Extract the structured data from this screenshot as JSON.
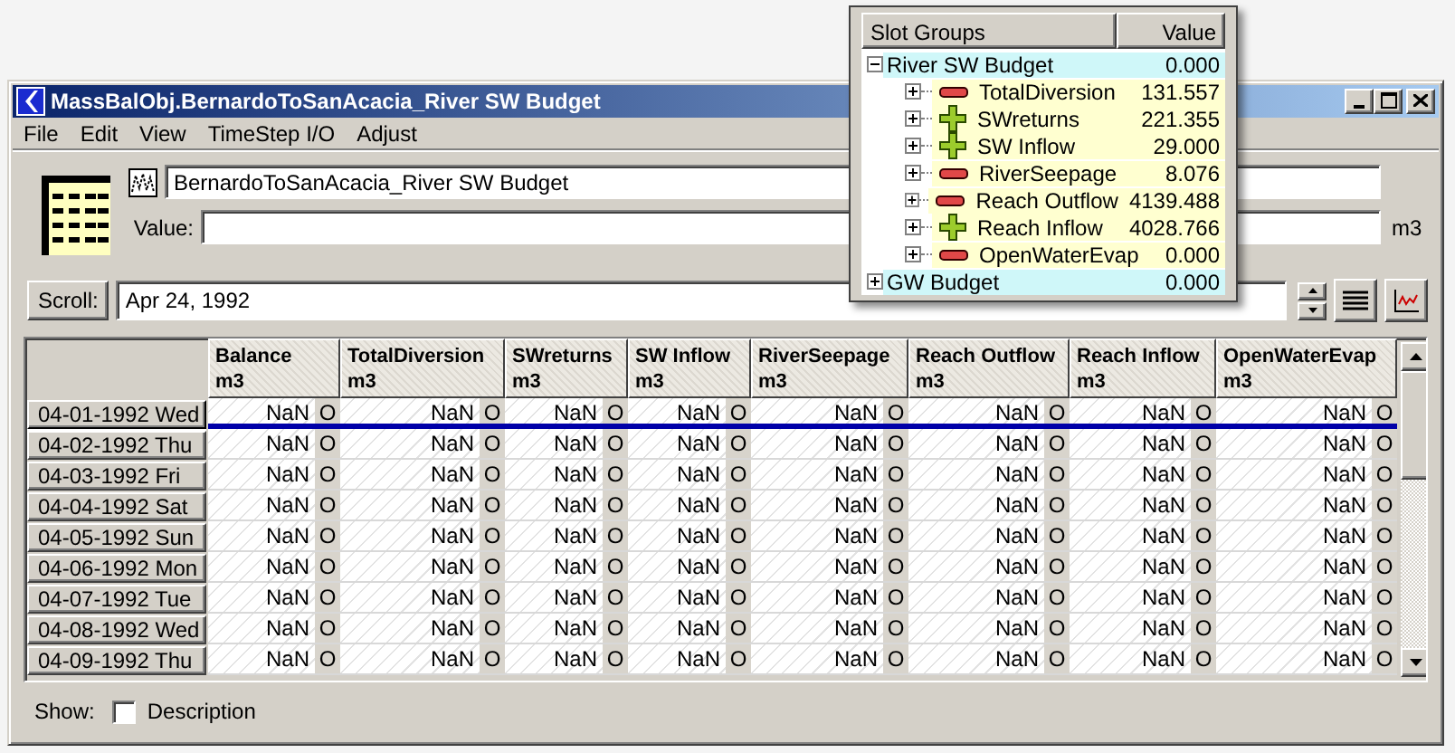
{
  "window": {
    "title": "MassBalObj.BernardoToSanAcacia_River SW Budget"
  },
  "menu": [
    "File",
    "Edit",
    "View",
    "TimeStep I/O",
    "Adjust"
  ],
  "object_name": "BernardoToSanAcacia_River SW Budget",
  "value_field": {
    "label": "Value:",
    "unit": "m3"
  },
  "scroll": {
    "button": "Scroll:",
    "value": "Apr 24, 1992"
  },
  "table": {
    "columns": [
      {
        "name": "Balance",
        "unit": "m3"
      },
      {
        "name": "TotalDiversion",
        "unit": "m3"
      },
      {
        "name": "SWreturns",
        "unit": "m3"
      },
      {
        "name": "SW Inflow",
        "unit": "m3"
      },
      {
        "name": "RiverSeepage",
        "unit": "m3"
      },
      {
        "name": "Reach Outflow",
        "unit": "m3"
      },
      {
        "name": "Reach Inflow",
        "unit": "m3"
      },
      {
        "name": "OpenWaterEvap",
        "unit": "m3"
      }
    ],
    "rows": [
      {
        "date": "04-01-1992 Wed",
        "selected": true,
        "cells": [
          {
            "value": "NaN",
            "flag": "O"
          },
          {
            "value": "NaN",
            "flag": "O"
          },
          {
            "value": "NaN",
            "flag": "O"
          },
          {
            "value": "NaN",
            "flag": "O"
          },
          {
            "value": "NaN",
            "flag": "O"
          },
          {
            "value": "NaN",
            "flag": "O"
          },
          {
            "value": "NaN",
            "flag": "O"
          },
          {
            "value": "NaN",
            "flag": "O"
          }
        ]
      },
      {
        "date": "04-02-1992 Thu",
        "selected": false,
        "cells": [
          {
            "value": "NaN",
            "flag": "O"
          },
          {
            "value": "NaN",
            "flag": "O"
          },
          {
            "value": "NaN",
            "flag": "O"
          },
          {
            "value": "NaN",
            "flag": "O"
          },
          {
            "value": "NaN",
            "flag": "O"
          },
          {
            "value": "NaN",
            "flag": "O"
          },
          {
            "value": "NaN",
            "flag": "O"
          },
          {
            "value": "NaN",
            "flag": "O"
          }
        ]
      },
      {
        "date": "04-03-1992 Fri",
        "selected": false,
        "cells": [
          {
            "value": "NaN",
            "flag": "O"
          },
          {
            "value": "NaN",
            "flag": "O"
          },
          {
            "value": "NaN",
            "flag": "O"
          },
          {
            "value": "NaN",
            "flag": "O"
          },
          {
            "value": "NaN",
            "flag": "O"
          },
          {
            "value": "NaN",
            "flag": "O"
          },
          {
            "value": "NaN",
            "flag": "O"
          },
          {
            "value": "NaN",
            "flag": "O"
          }
        ]
      },
      {
        "date": "04-04-1992 Sat",
        "selected": false,
        "cells": [
          {
            "value": "NaN",
            "flag": "O"
          },
          {
            "value": "NaN",
            "flag": "O"
          },
          {
            "value": "NaN",
            "flag": "O"
          },
          {
            "value": "NaN",
            "flag": "O"
          },
          {
            "value": "NaN",
            "flag": "O"
          },
          {
            "value": "NaN",
            "flag": "O"
          },
          {
            "value": "NaN",
            "flag": "O"
          },
          {
            "value": "NaN",
            "flag": "O"
          }
        ]
      },
      {
        "date": "04-05-1992 Sun",
        "selected": false,
        "cells": [
          {
            "value": "NaN",
            "flag": "O"
          },
          {
            "value": "NaN",
            "flag": "O"
          },
          {
            "value": "NaN",
            "flag": "O"
          },
          {
            "value": "NaN",
            "flag": "O"
          },
          {
            "value": "NaN",
            "flag": "O"
          },
          {
            "value": "NaN",
            "flag": "O"
          },
          {
            "value": "NaN",
            "flag": "O"
          },
          {
            "value": "NaN",
            "flag": "O"
          }
        ]
      },
      {
        "date": "04-06-1992 Mon",
        "selected": false,
        "cells": [
          {
            "value": "NaN",
            "flag": "O"
          },
          {
            "value": "NaN",
            "flag": "O"
          },
          {
            "value": "NaN",
            "flag": "O"
          },
          {
            "value": "NaN",
            "flag": "O"
          },
          {
            "value": "NaN",
            "flag": "O"
          },
          {
            "value": "NaN",
            "flag": "O"
          },
          {
            "value": "NaN",
            "flag": "O"
          },
          {
            "value": "NaN",
            "flag": "O"
          }
        ]
      },
      {
        "date": "04-07-1992 Tue",
        "selected": false,
        "cells": [
          {
            "value": "NaN",
            "flag": "O"
          },
          {
            "value": "NaN",
            "flag": "O"
          },
          {
            "value": "NaN",
            "flag": "O"
          },
          {
            "value": "NaN",
            "flag": "O"
          },
          {
            "value": "NaN",
            "flag": "O"
          },
          {
            "value": "NaN",
            "flag": "O"
          },
          {
            "value": "NaN",
            "flag": "O"
          },
          {
            "value": "NaN",
            "flag": "O"
          }
        ]
      },
      {
        "date": "04-08-1992 Wed",
        "selected": false,
        "cells": [
          {
            "value": "NaN",
            "flag": "O"
          },
          {
            "value": "NaN",
            "flag": "O"
          },
          {
            "value": "NaN",
            "flag": "O"
          },
          {
            "value": "NaN",
            "flag": "O"
          },
          {
            "value": "NaN",
            "flag": "O"
          },
          {
            "value": "NaN",
            "flag": "O"
          },
          {
            "value": "NaN",
            "flag": "O"
          },
          {
            "value": "NaN",
            "flag": "O"
          }
        ]
      },
      {
        "date": "04-09-1992 Thu",
        "selected": false,
        "cells": [
          {
            "value": "NaN",
            "flag": "O"
          },
          {
            "value": "NaN",
            "flag": "O"
          },
          {
            "value": "NaN",
            "flag": "O"
          },
          {
            "value": "NaN",
            "flag": "O"
          },
          {
            "value": "NaN",
            "flag": "O"
          },
          {
            "value": "NaN",
            "flag": "O"
          },
          {
            "value": "NaN",
            "flag": "O"
          },
          {
            "value": "NaN",
            "flag": "O"
          }
        ]
      }
    ]
  },
  "show": {
    "label": "Show:",
    "options": [
      {
        "label": "Description",
        "checked": false
      }
    ]
  },
  "popup": {
    "columns": [
      "Slot Groups",
      "Value"
    ],
    "groups": [
      {
        "label": "River SW Budget",
        "value": "0.000",
        "expanded": true,
        "children": [
          {
            "label": "TotalDiversion",
            "value": "131.557",
            "kind": "minus",
            "expanded": false
          },
          {
            "label": "SWreturns",
            "value": "221.355",
            "kind": "plus",
            "expanded": false
          },
          {
            "label": "SW Inflow",
            "value": "29.000",
            "kind": "plus",
            "expanded": false
          },
          {
            "label": "RiverSeepage",
            "value": "8.076",
            "kind": "minus",
            "expanded": false
          },
          {
            "label": "Reach Outflow",
            "value": "4139.488",
            "kind": "minus",
            "expanded": false
          },
          {
            "label": "Reach Inflow",
            "value": "4028.766",
            "kind": "plus",
            "expanded": false
          },
          {
            "label": "OpenWaterEvap",
            "value": "0.000",
            "kind": "minus",
            "expanded": false
          }
        ]
      },
      {
        "label": "GW Budget",
        "value": "0.000",
        "expanded": false
      }
    ]
  }
}
